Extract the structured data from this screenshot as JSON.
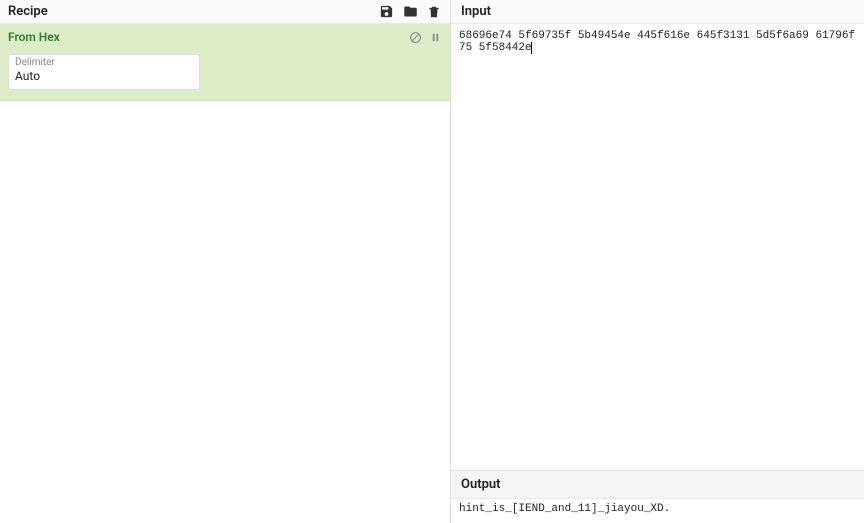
{
  "recipe": {
    "title": "Recipe",
    "operations": [
      {
        "name": "From Hex",
        "args": {
          "delimiter_label": "Delimiter",
          "delimiter_value": "Auto"
        }
      }
    ]
  },
  "input": {
    "title": "Input",
    "text": "68696e74 5f69735f 5b49454e 445f616e 645f3131 5d5f6a69 61796f75 5f58442e"
  },
  "output": {
    "title": "Output",
    "text": "hint_is_[IEND_and_11]_jiayou_XD."
  }
}
